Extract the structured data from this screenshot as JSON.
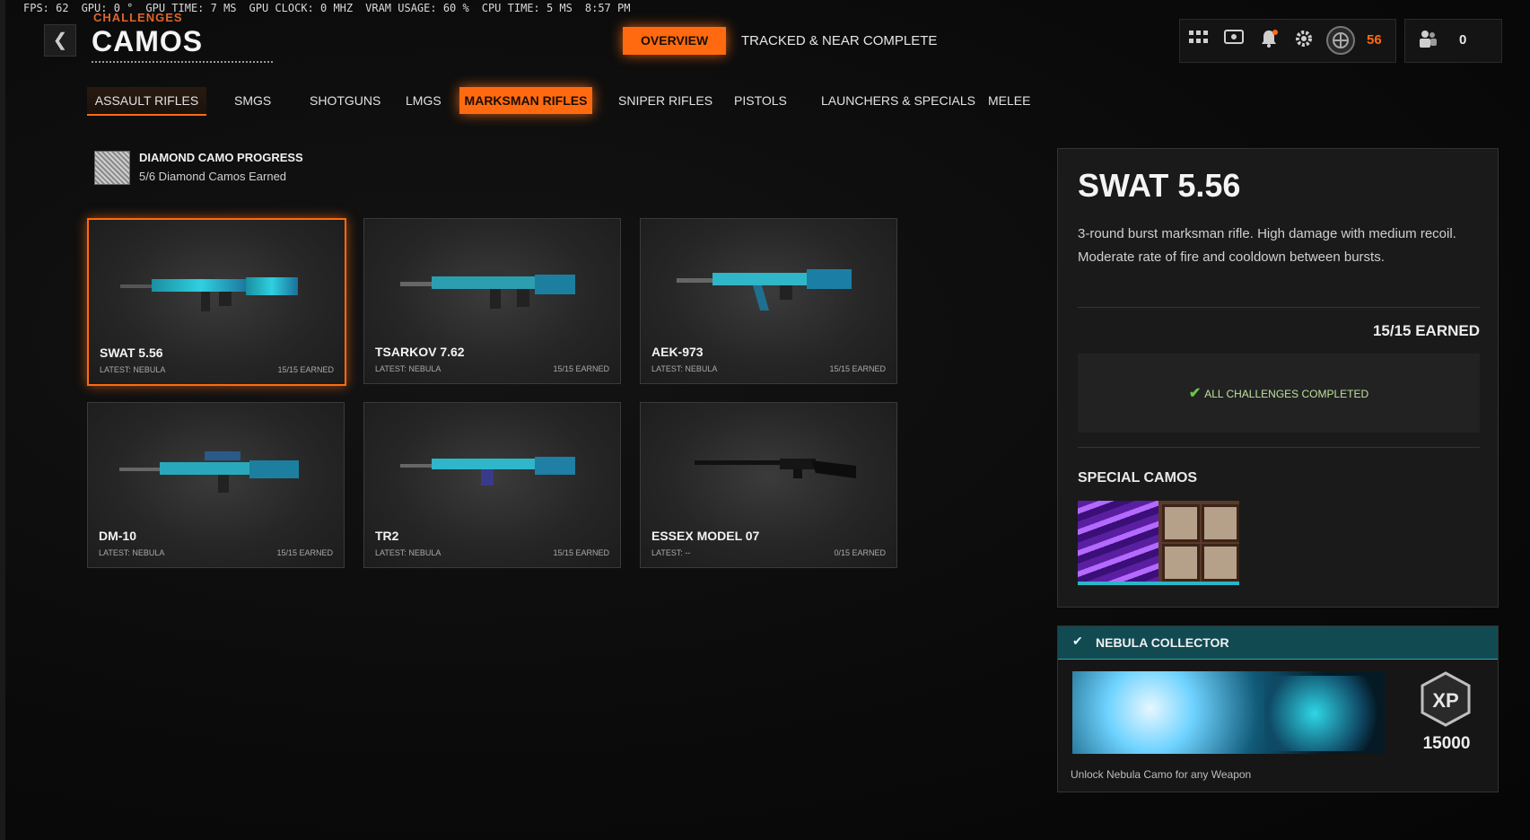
{
  "perf": {
    "fps": "FPS:  62",
    "gpu": "GPU: 0 °",
    "gpu_time": "GPU TIME:  7 MS",
    "gpu_clock": "GPU CLOCK: 0 MHZ",
    "vram": "VRAM USAGE: 60 %",
    "cpu_time": "CPU TIME:  5 MS",
    "clock": "8:57 PM"
  },
  "header": {
    "back": "❮",
    "breadcrumb": "CHALLENGES",
    "title": "CAMOS",
    "nav": [
      "OVERVIEW",
      "TRACKED & NEAR COMPLETE"
    ],
    "tokens": "56",
    "social_count": "0"
  },
  "categories": [
    "ASSAULT RIFLES",
    "SMGS",
    "SHOTGUNS",
    "LMGS",
    "MARKSMAN RIFLES",
    "SNIPER RIFLES",
    "PISTOLS",
    "LAUNCHERS & SPECIALS",
    "MELEE"
  ],
  "diamond": {
    "title": "DIAMOND CAMO PROGRESS",
    "subtitle": "5/6 Diamond Camos Earned"
  },
  "weapons": [
    {
      "name": "SWAT 5.56",
      "latest": "LATEST: NEBULA",
      "earned": "15/15 EARNED"
    },
    {
      "name": "TSARKOV 7.62",
      "latest": "LATEST: NEBULA",
      "earned": "15/15 EARNED"
    },
    {
      "name": "AEK-973",
      "latest": "LATEST: NEBULA",
      "earned": "15/15 EARNED"
    },
    {
      "name": "DM-10",
      "latest": "LATEST: NEBULA",
      "earned": "15/15 EARNED"
    },
    {
      "name": "TR2",
      "latest": "LATEST: NEBULA",
      "earned": "15/15 EARNED"
    },
    {
      "name": "ESSEX MODEL 07",
      "latest": "LATEST: --",
      "earned": "0/15 EARNED"
    }
  ],
  "detail": {
    "title": "SWAT 5.56",
    "description": "3-round burst marksman rifle.  High damage with medium recoil. Moderate rate of fire and cooldown between bursts.",
    "earned": "15/15 EARNED",
    "challenges_status": "ALL CHALLENGES COMPLETED",
    "special_title": "SPECIAL CAMOS"
  },
  "nebula": {
    "title": "NEBULA COLLECTOR",
    "xp": "15000",
    "xp_label": "XP",
    "description": "Unlock Nebula Camo for any Weapon"
  },
  "colors": {
    "accent": "#ff6a10",
    "nebula": "#28b6c8",
    "complete": "#6ec24a"
  }
}
